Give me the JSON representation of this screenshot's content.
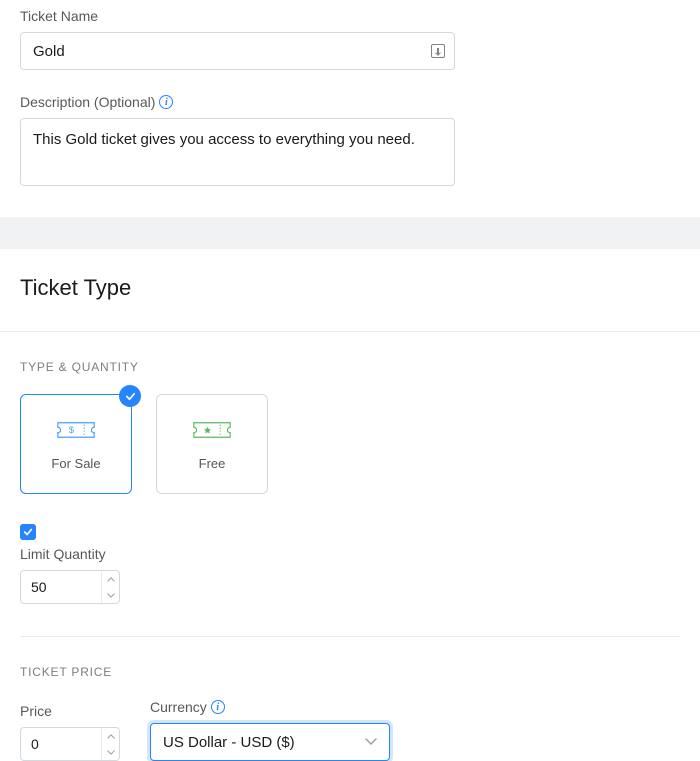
{
  "ticket": {
    "name_label": "Ticket Name",
    "name_value": "Gold",
    "description_label": "Description (Optional)",
    "description_value": "This Gold ticket gives you access to everything you need."
  },
  "section_title": "Ticket Type",
  "type_quantity": {
    "label": "TYPE & QUANTITY",
    "for_sale": "For Sale",
    "free": "Free",
    "limit_quantity_label": "Limit Quantity",
    "quantity_value": "50"
  },
  "ticket_price": {
    "label": "TICKET PRICE",
    "price_label": "Price",
    "price_value": "0",
    "currency_label": "Currency",
    "currency_value": "US Dollar - USD ($)"
  }
}
